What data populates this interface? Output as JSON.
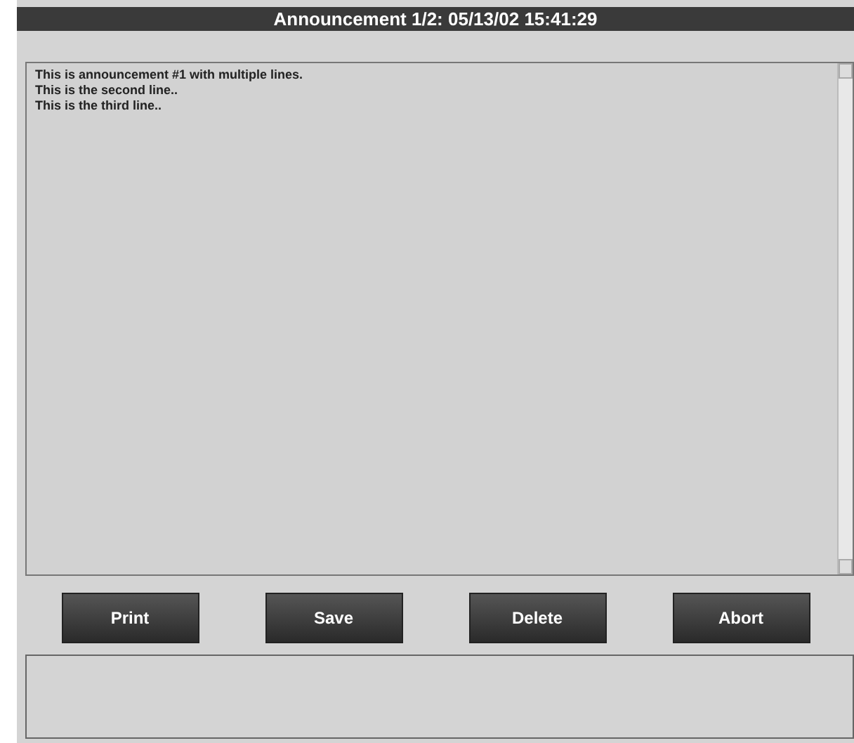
{
  "window": {
    "title": "Announcement 1/2: 05/13/02 15:41:29"
  },
  "message": {
    "lines": [
      "This is announcement #1 with multiple lines.",
      "This is the second line..",
      "This is the third line.."
    ]
  },
  "buttons": [
    {
      "label": "Print"
    },
    {
      "label": "Save"
    },
    {
      "label": "Delete"
    },
    {
      "label": "Abort"
    }
  ]
}
